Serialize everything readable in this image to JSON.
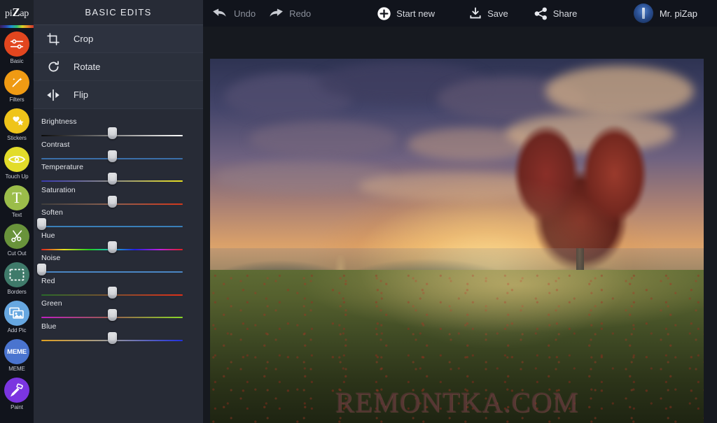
{
  "brand": {
    "logo_text_pre": "pi",
    "logo_text_z": "Z",
    "logo_text_post": "ap",
    "icon": "pizap-logo"
  },
  "rail": {
    "items": [
      {
        "label": "Basic",
        "icon": "sliders-icon",
        "color": "#e2461f"
      },
      {
        "label": "Filters",
        "icon": "wand-icon",
        "color": "#ef9a13"
      },
      {
        "label": "Stickers",
        "icon": "star-heart-icon",
        "color": "#efc41a"
      },
      {
        "label": "Touch Up",
        "icon": "eye-icon",
        "color": "#e2dc2a"
      },
      {
        "label": "Text",
        "icon": "text-t-icon",
        "color": "#9bbd4a"
      },
      {
        "label": "Cut Out",
        "icon": "scissors-icon",
        "color": "#69933b"
      },
      {
        "label": "Borders",
        "icon": "frame-icon",
        "color": "#3f7a6a"
      },
      {
        "label": "Add Pic",
        "icon": "photos-icon",
        "color": "#66a7e0"
      },
      {
        "label": "MEME",
        "icon": "meme-icon",
        "color": "#4a74cf"
      },
      {
        "label": "Paint",
        "icon": "paint-roller-icon",
        "color": "#7b35e0"
      }
    ]
  },
  "panel": {
    "title": "BASIC EDITS",
    "edits": [
      {
        "label": "Crop",
        "icon": "crop-icon"
      },
      {
        "label": "Rotate",
        "icon": "rotate-icon"
      },
      {
        "label": "Flip",
        "icon": "flip-icon"
      }
    ],
    "sliders": [
      {
        "name": "Brightness",
        "value": 50,
        "gradient": "linear-gradient(to right,#0a0a0a,#ffffff)"
      },
      {
        "name": "Contrast",
        "value": 50,
        "gradient": "linear-gradient(to right,#3a6ea8,#3a6ea8)"
      },
      {
        "name": "Temperature",
        "value": 50,
        "gradient": "linear-gradient(to right,#3a3ab0,#8a8a8a 48%,#e8e020)"
      },
      {
        "name": "Saturation",
        "value": 50,
        "gradient": "linear-gradient(to right,#3d3d3d,#8a6050 48%,#d4381c)"
      },
      {
        "name": "Soften",
        "value": 0,
        "gradient": "linear-gradient(to right,#3a7fb8,#3a7fb8)"
      },
      {
        "name": "Hue",
        "value": 50,
        "gradient": "linear-gradient(to right,#e02020,#e8e020 16%,#20d020 34%,#20c0d0 50%,#2020e0 66%,#c020e0 84%,#e02020)"
      },
      {
        "name": "Noise",
        "value": 0,
        "gradient": "linear-gradient(to right,#4a86c4,#4a86c4)"
      },
      {
        "name": "Red",
        "value": 50,
        "gradient": "linear-gradient(to right,#2a6a2a,#7a5030 48%,#e03018)"
      },
      {
        "name": "Green",
        "value": 50,
        "gradient": "linear-gradient(to right,#c020c0,#9a5a50 48%,#8ad828)"
      },
      {
        "name": "Blue",
        "value": 50,
        "gradient": "linear-gradient(to right,#e0a020,#9a9a9a 48%,#2030e0)"
      }
    ]
  },
  "topbar": {
    "undo_label": "Undo",
    "redo_label": "Redo",
    "start_new_label": "Start new",
    "save_label": "Save",
    "share_label": "Share",
    "username": "Mr. piZap",
    "icons": {
      "undo": "undo-arrow-icon",
      "redo": "redo-arrow-icon",
      "start_new": "plus-circle-icon",
      "save": "download-icon",
      "share": "share-nodes-icon",
      "avatar": "user-avatar",
      "menu": "hamburger-menu-icon"
    }
  },
  "canvas": {
    "watermark": "REMONTKA.COM",
    "photo_alt": "heart-shaped-tree-sunset-photo"
  }
}
